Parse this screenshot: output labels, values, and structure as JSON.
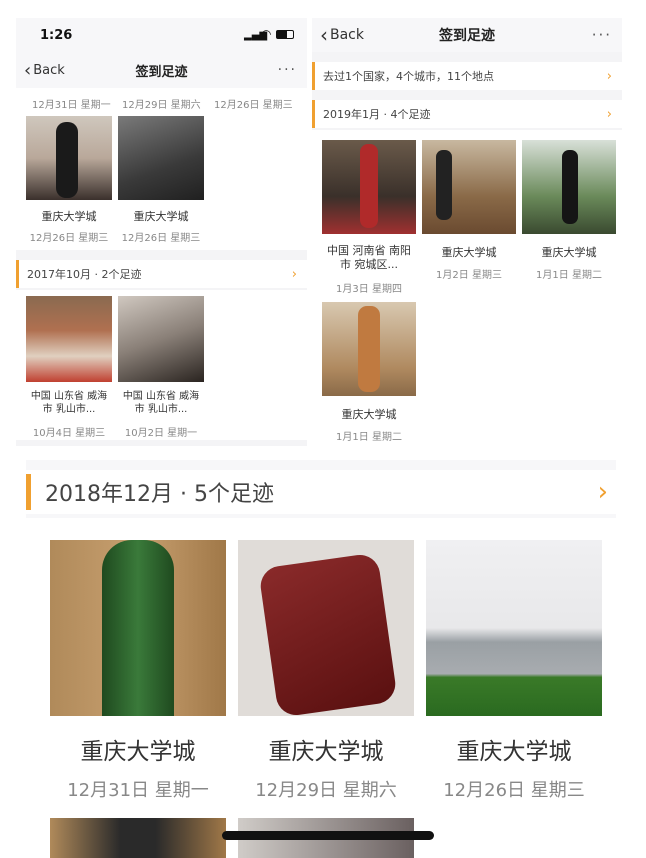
{
  "status": {
    "time": "1:26"
  },
  "left": {
    "nav": {
      "back": "Back",
      "title": "签到足迹",
      "more": "···"
    },
    "top_dates": [
      "12月31日 星期一",
      "12月29日 星期六",
      "12月26日 星期三"
    ],
    "cards_a": [
      {
        "title": "重庆大学城",
        "date": "12月26日 星期三"
      },
      {
        "title": "重庆大学城",
        "date": "12月26日 星期三"
      }
    ],
    "section": "2017年10月 · 2个足迹",
    "cards_b": [
      {
        "title": "中国 山东省 威海市 乳山市...",
        "date": "10月4日 星期三"
      },
      {
        "title": "中国 山东省 威海市 乳山市...",
        "date": "10月2日 星期一"
      }
    ]
  },
  "right": {
    "nav": {
      "back": "Back",
      "title": "签到足迹",
      "more": "···"
    },
    "summary": "去过1个国家，4个城市，11个地点",
    "section": "2019年1月 · 4个足迹",
    "cards": [
      {
        "title": "中国 河南省 南阳市 宛城区...",
        "date": "1月3日 星期四"
      },
      {
        "title": "重庆大学城",
        "date": "1月2日 星期三"
      },
      {
        "title": "重庆大学城",
        "date": "1月1日 星期二"
      },
      {
        "title": "重庆大学城",
        "date": "1月1日 星期二"
      }
    ]
  },
  "bottom": {
    "section": "2018年12月 · 5个足迹",
    "cards": [
      {
        "title": "重庆大学城",
        "date": "12月31日 星期一"
      },
      {
        "title": "重庆大学城",
        "date": "12月29日 星期六"
      },
      {
        "title": "重庆大学城",
        "date": "12月26日 星期三"
      }
    ]
  },
  "colors": {
    "accent": "#f0a030",
    "panel_bg": "#f4f4f6"
  }
}
